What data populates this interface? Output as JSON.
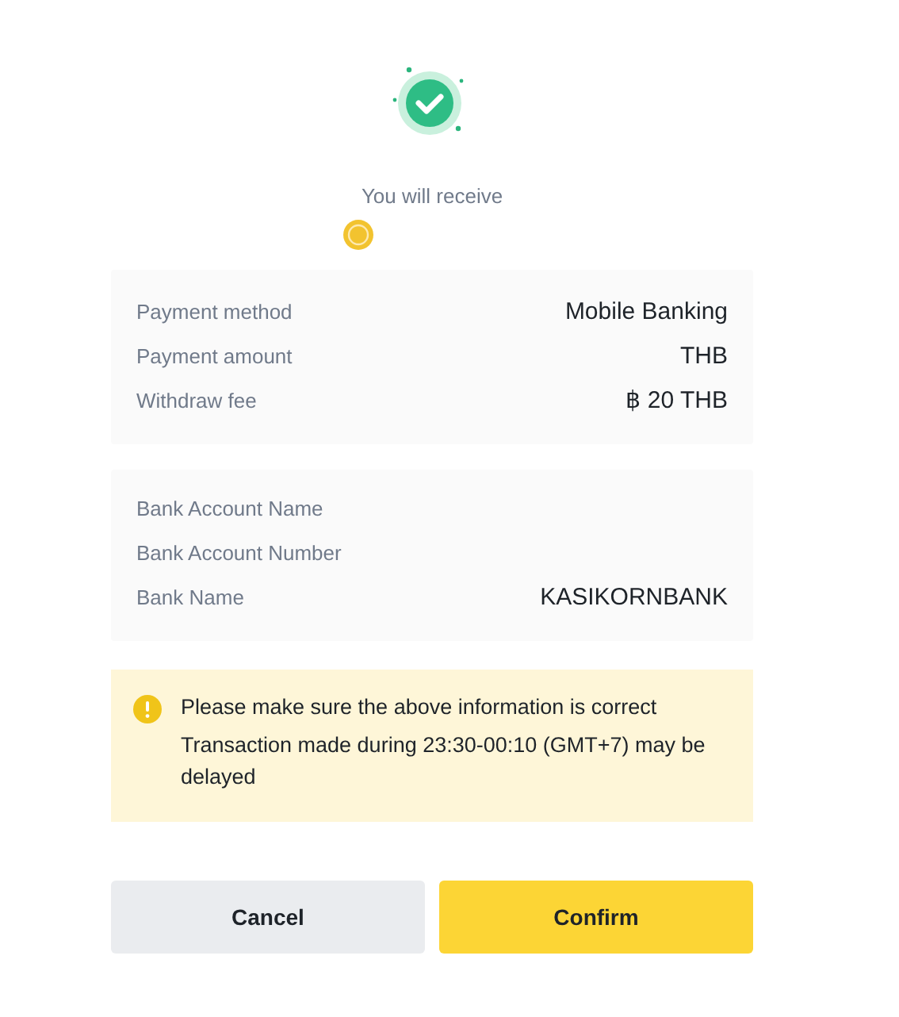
{
  "heading": "You will receive",
  "payment_details": [
    {
      "label": "Payment method",
      "value": "Mobile Banking"
    },
    {
      "label": "Payment amount",
      "value": "THB"
    },
    {
      "label": "Withdraw fee",
      "value": "฿ 20 THB"
    }
  ],
  "bank_details": [
    {
      "label": "Bank Account Name"
    },
    {
      "label": "Bank Account Number"
    },
    {
      "label": "Bank Name",
      "value": "KASIKORNBANK"
    }
  ],
  "notice": [
    "Please make sure the above information is correct",
    "Transaction made during 23:30-00:10 (GMT+7) may be delayed"
  ],
  "buttons": [
    {
      "label": "Cancel",
      "kind": "secondary"
    },
    {
      "label": "Confirm",
      "kind": "primary"
    }
  ]
}
